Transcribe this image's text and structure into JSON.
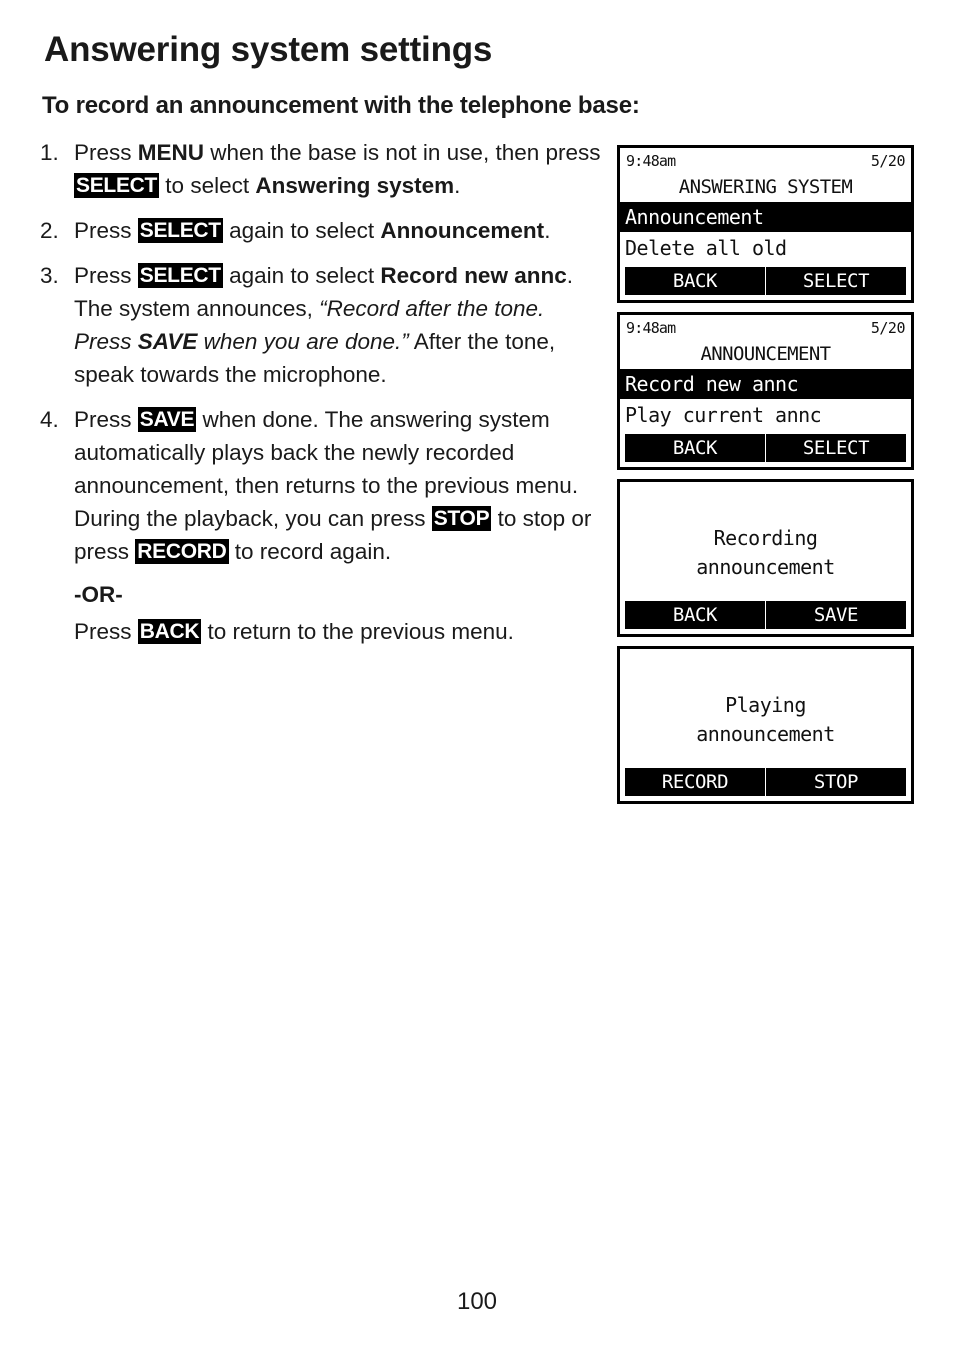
{
  "document": {
    "page_title": "Answering system settings",
    "section_title": "To record an announcement with the telephone base:",
    "page_number": "100"
  },
  "steps": [
    {
      "number": "1.",
      "parts": [
        {
          "t": "Press ",
          "style": "normal"
        },
        {
          "t": "MENU",
          "style": "bold"
        },
        {
          "t": " when the base is not in use, then press ",
          "style": "normal"
        },
        {
          "t": "SELECT",
          "style": "key"
        },
        {
          "t": " to select ",
          "style": "normal"
        },
        {
          "t": "Answering system",
          "style": "bold"
        },
        {
          "t": ".",
          "style": "normal"
        }
      ]
    },
    {
      "number": "2.",
      "parts": [
        {
          "t": "Press ",
          "style": "normal"
        },
        {
          "t": "SELECT",
          "style": "key"
        },
        {
          "t": " again to select ",
          "style": "normal"
        },
        {
          "t": "Announcement",
          "style": "bold"
        },
        {
          "t": ".",
          "style": "normal"
        }
      ]
    },
    {
      "number": "3.",
      "parts": [
        {
          "t": "Press ",
          "style": "normal"
        },
        {
          "t": "SELECT",
          "style": "key"
        },
        {
          "t": " again to select ",
          "style": "normal"
        },
        {
          "t": "Record new annc",
          "style": "bold"
        },
        {
          "t": ". The system announces, ",
          "style": "normal"
        },
        {
          "t": "“Record after the tone. Press ",
          "style": "italic"
        },
        {
          "t": "SAVE",
          "style": "bold-italic"
        },
        {
          "t": " when you are done.”",
          "style": "italic"
        },
        {
          "t": " After the tone, speak towards the microphone.",
          "style": "normal"
        }
      ]
    },
    {
      "number": "4.",
      "parts": [
        {
          "t": "Press ",
          "style": "normal"
        },
        {
          "t": "SAVE",
          "style": "key"
        },
        {
          "t": " when done. The answering system automatically plays back the newly recorded announcement, then returns to the previous menu. During the playback, you can press ",
          "style": "normal"
        },
        {
          "t": "STOP",
          "style": "key"
        },
        {
          "t": " to stop or press ",
          "style": "normal"
        },
        {
          "t": "RECORD",
          "style": "key"
        },
        {
          "t": " to record again.",
          "style": "normal"
        }
      ]
    }
  ],
  "alternative": {
    "or_label": "-OR-",
    "parts": [
      {
        "t": "Press ",
        "style": "normal"
      },
      {
        "t": "BACK",
        "style": "key"
      },
      {
        "t": " to return to the previous menu.",
        "style": "normal"
      }
    ]
  },
  "lcd_screens": [
    {
      "id": "answering-system-menu",
      "has_statusbar": true,
      "status_left": "9:48am",
      "status_right": "5/20",
      "heading": "ANSWERING SYSTEM",
      "rows": [
        {
          "label": "Announcement",
          "selected": true
        },
        {
          "label": "Delete all old",
          "selected": false
        }
      ],
      "center_lines": [],
      "softkeys": [
        {
          "label": "BACK"
        },
        {
          "label": "SELECT"
        }
      ]
    },
    {
      "id": "announcement-menu",
      "has_statusbar": true,
      "status_left": "9:48am",
      "status_right": "5/20",
      "heading": "ANNOUNCEMENT",
      "rows": [
        {
          "label": "Record new annc",
          "selected": true
        },
        {
          "label": "Play current annc",
          "selected": false
        }
      ],
      "center_lines": [],
      "softkeys": [
        {
          "label": "BACK"
        },
        {
          "label": "SELECT"
        }
      ]
    },
    {
      "id": "recording-announcement",
      "has_statusbar": false,
      "status_left": "",
      "status_right": "",
      "heading": "",
      "rows": [],
      "center_lines": [
        "Recording",
        "announcement"
      ],
      "softkeys": [
        {
          "label": "BACK"
        },
        {
          "label": "SAVE"
        }
      ]
    },
    {
      "id": "playing-announcement",
      "has_statusbar": false,
      "status_left": "",
      "status_right": "",
      "heading": "",
      "rows": [],
      "center_lines": [
        "Playing",
        "announcement"
      ],
      "softkeys": [
        {
          "label": "RECORD"
        },
        {
          "label": "STOP"
        }
      ]
    }
  ]
}
